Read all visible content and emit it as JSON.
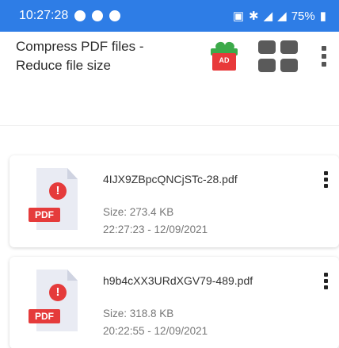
{
  "status_bar": {
    "time": "10:27:28",
    "battery": "75%",
    "bg_color": "#2e7de6"
  },
  "app_bar": {
    "title_line1": "Compress PDF files -",
    "title_line2": "Reduce file size",
    "ad_label": "AD",
    "icons": [
      "gift-ad-icon",
      "grid-view-icon",
      "more-vertical-icon"
    ]
  },
  "files": [
    {
      "name": "4IJX9ZBpcQNCjSTc-28.pdf",
      "size": "Size: 273.4 KB",
      "datetime": "22:27:23 - 12/09/2021",
      "badge": "PDF"
    },
    {
      "name": "h9b4cXX3URdXGV79-489.pdf",
      "size": "Size: 318.8 KB",
      "datetime": "20:22:55 - 12/09/2021",
      "badge": "PDF"
    }
  ]
}
